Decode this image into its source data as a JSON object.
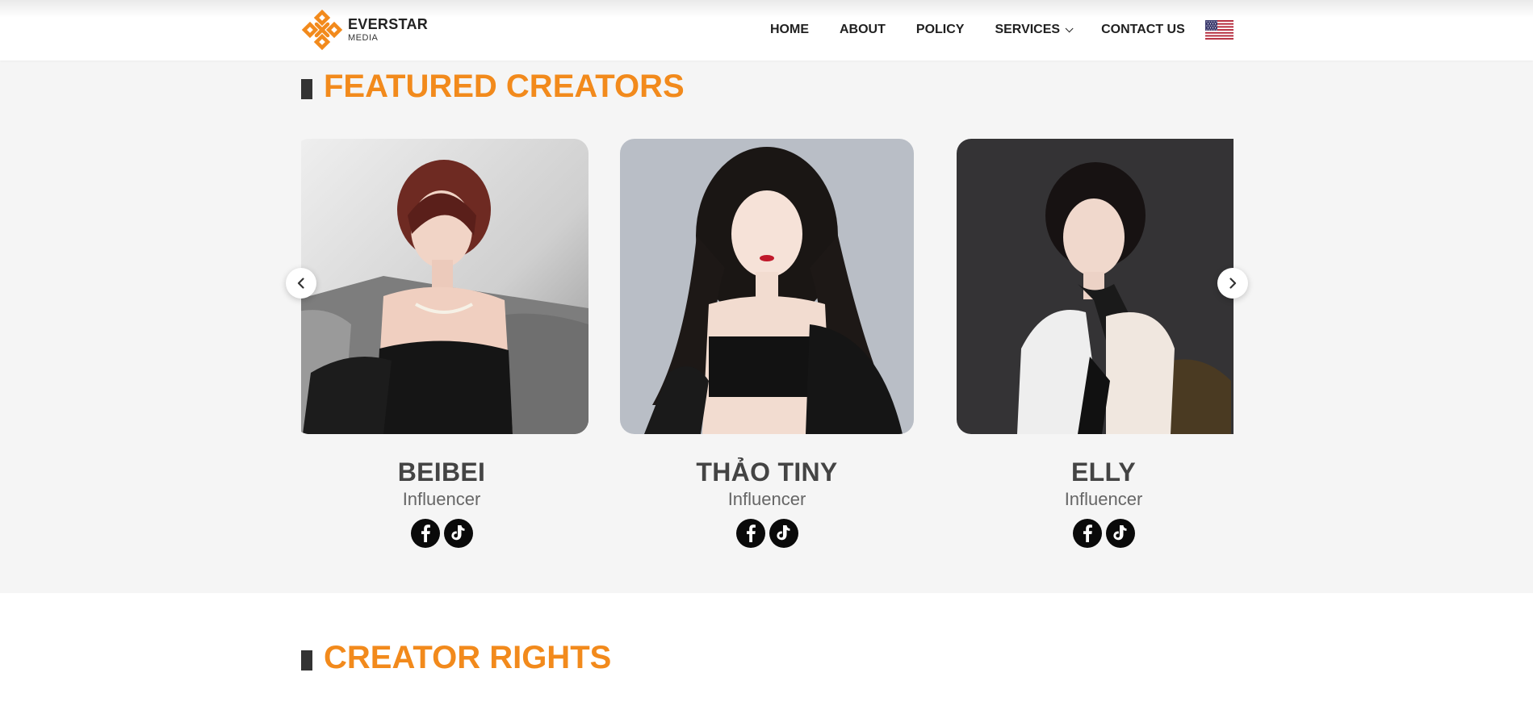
{
  "brand": {
    "name": "EVERSTAR",
    "sub": "MEDIA",
    "accent_color": "#f28a1c"
  },
  "nav": {
    "items": [
      {
        "label": "HOME"
      },
      {
        "label": "ABOUT"
      },
      {
        "label": "POLICY"
      },
      {
        "label": "SERVICES",
        "has_dropdown": true
      },
      {
        "label": "CONTACT US"
      }
    ],
    "language_icon": "us-flag-icon"
  },
  "featured": {
    "title": "FEATURED CREATORS",
    "prev_icon": "chevron-left-icon",
    "next_icon": "chevron-right-icon",
    "creators": [
      {
        "name": "BEIBEI",
        "role": "Influencer",
        "socials": [
          "facebook-icon",
          "tiktok-icon"
        ]
      },
      {
        "name": "THẢO TINY",
        "role": "Influencer",
        "socials": [
          "facebook-icon",
          "tiktok-icon"
        ]
      },
      {
        "name": "ELLY",
        "role": "Influencer",
        "socials": [
          "facebook-icon",
          "tiktok-icon"
        ]
      }
    ]
  },
  "rights": {
    "title": "CREATOR RIGHTS"
  }
}
